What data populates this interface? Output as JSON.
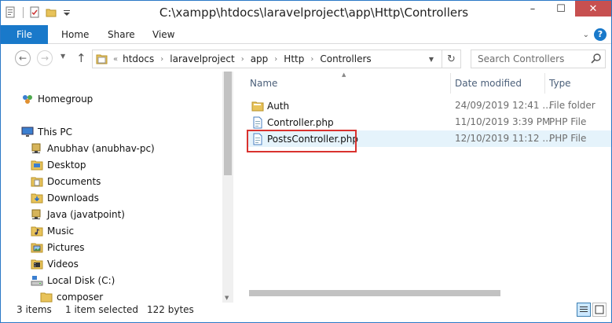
{
  "window": {
    "title": "C:\\xampp\\htdocs\\laravelproject\\app\\Http\\Controllers",
    "controls": {
      "minimize": "–",
      "maximize": "☐",
      "close": "✕"
    }
  },
  "ribbon": {
    "tabs": [
      "File",
      "Home",
      "Share",
      "View"
    ],
    "help": "?"
  },
  "address": {
    "lead": "«",
    "crumbs": [
      "htdocs",
      "laravelproject",
      "app",
      "Http",
      "Controllers"
    ],
    "search_placeholder": "Search Controllers"
  },
  "nav": {
    "items": [
      {
        "label": "Homegroup",
        "icon": "homegroup-icon"
      },
      {
        "label": "This PC",
        "icon": "computer-icon"
      },
      {
        "label": "Anubhav (anubhav-pc)",
        "icon": "network-drive-icon"
      },
      {
        "label": "Desktop",
        "icon": "folder-icon"
      },
      {
        "label": "Documents",
        "icon": "documents-icon"
      },
      {
        "label": "Downloads",
        "icon": "downloads-icon"
      },
      {
        "label": "Java (javatpoint)",
        "icon": "network-drive-icon"
      },
      {
        "label": "Music",
        "icon": "music-icon"
      },
      {
        "label": "Pictures",
        "icon": "pictures-icon"
      },
      {
        "label": "Videos",
        "icon": "videos-icon"
      },
      {
        "label": "Local Disk (C:)",
        "icon": "disk-icon"
      },
      {
        "label": "composer",
        "icon": "folder-icon"
      }
    ]
  },
  "columns": {
    "name": "Name",
    "date": "Date modified",
    "type": "Type"
  },
  "files": [
    {
      "name": "Auth",
      "date": "24/09/2019 12:41 ...",
      "type": "File folder",
      "icon": "folder-icon"
    },
    {
      "name": "Controller.php",
      "date": "11/10/2019 3:39 PM",
      "type": "PHP File",
      "icon": "php-file-icon"
    },
    {
      "name": "PostsController.php",
      "date": "12/10/2019 11:12 ...",
      "type": "PHP File",
      "icon": "php-file-icon",
      "selected": true
    }
  ],
  "status": {
    "count": "3 items",
    "selection": "1 item selected",
    "size": "122 bytes"
  },
  "colors": {
    "accent": "#1979ca",
    "selection": "#e5f3fb",
    "highlight": "#d9322e",
    "close": "#c75050"
  }
}
